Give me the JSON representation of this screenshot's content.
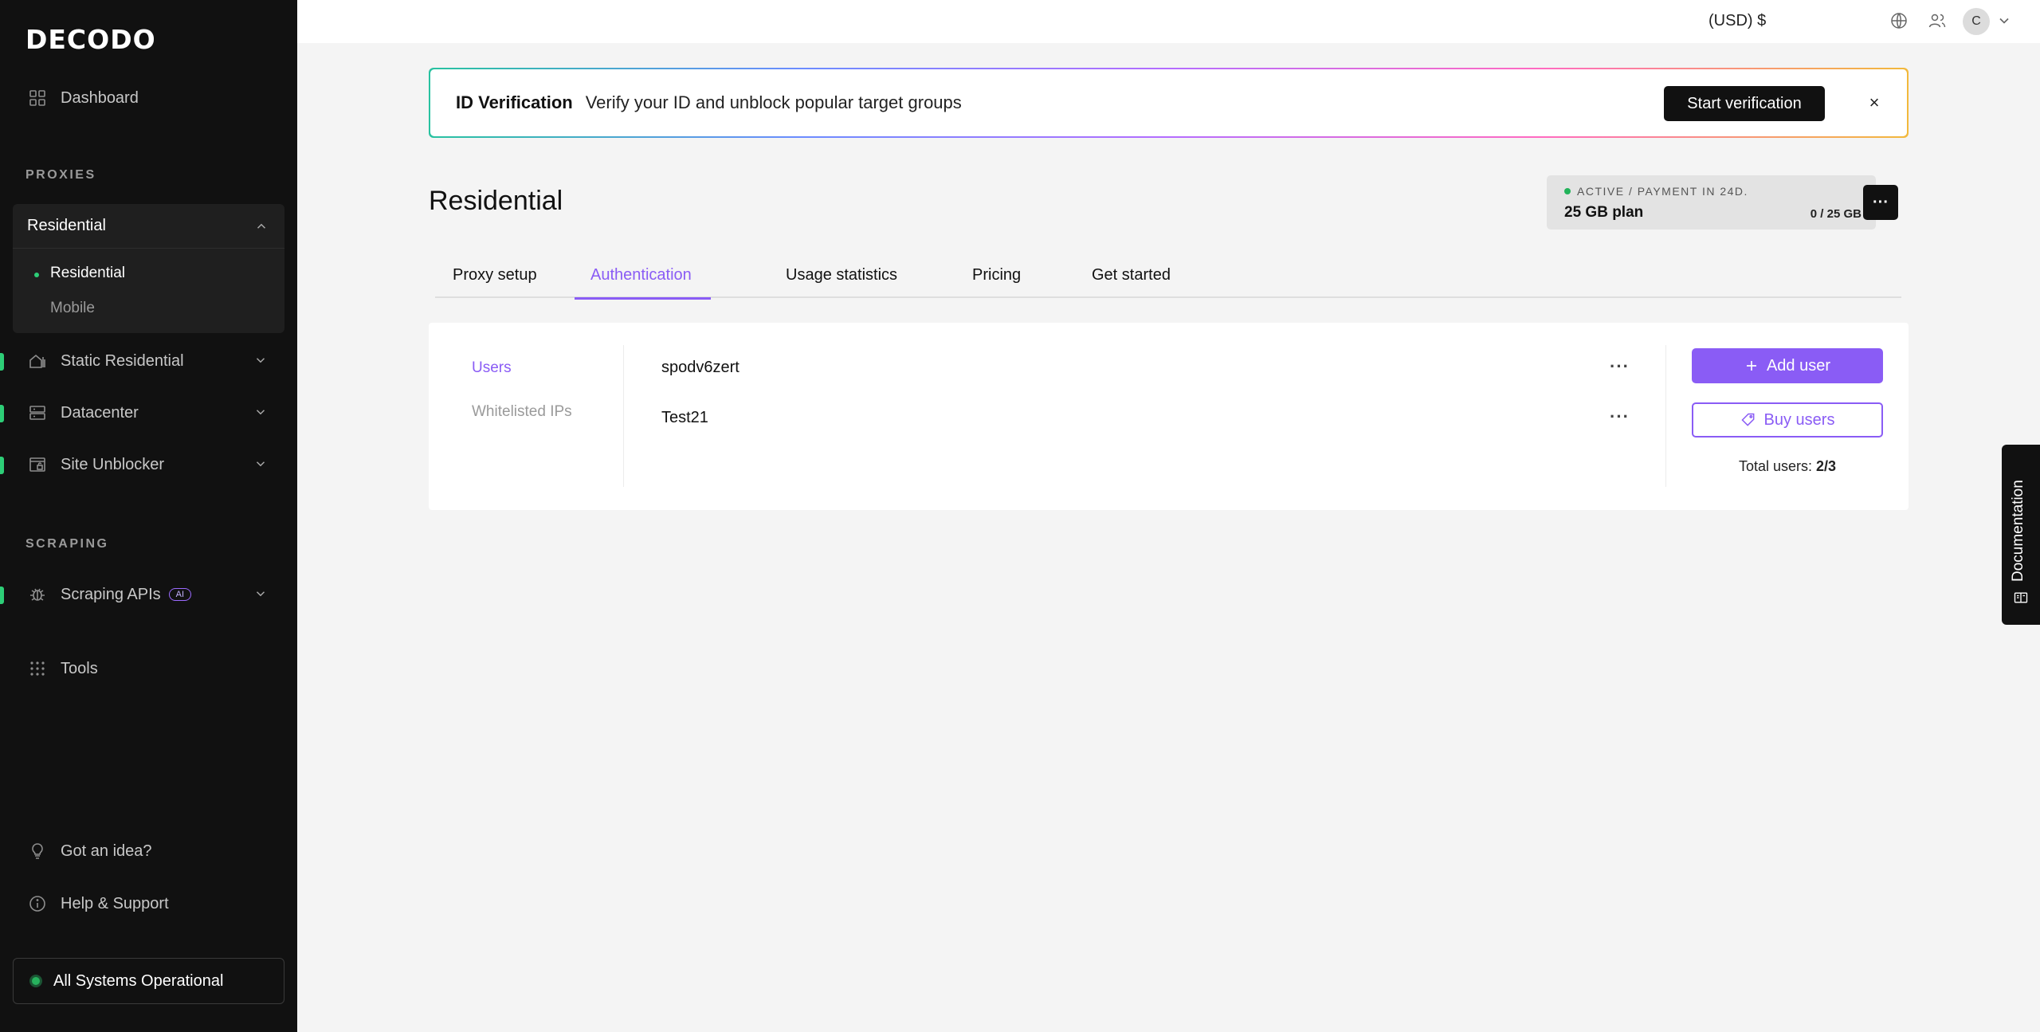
{
  "sidebar": {
    "logo": "DECODO",
    "dashboard": "Dashboard",
    "section_proxies": "PROXIES",
    "residential_group": "Residential",
    "residential_sub": [
      "Residential",
      "Mobile"
    ],
    "static_residential": "Static Residential",
    "datacenter": "Datacenter",
    "site_unblocker": "Site Unblocker",
    "section_scraping": "SCRAPING",
    "scraping_apis": "Scraping APIs",
    "ai_badge": "AI",
    "tools": "Tools",
    "got_idea": "Got an idea?",
    "help_support": "Help & Support",
    "status": "All Systems Operational"
  },
  "topbar": {
    "currency": "(USD) $",
    "avatar_initial": "C"
  },
  "banner": {
    "title": "ID Verification",
    "text": "Verify your ID and unblock popular target groups",
    "button": "Start verification",
    "close": "×"
  },
  "page": {
    "title": "Residential",
    "plan_status": "ACTIVE / PAYMENT IN 24D.",
    "plan_name": "25 GB plan",
    "plan_usage": "0 / 25 GB",
    "more": "···"
  },
  "tabs": [
    "Proxy setup",
    "Authentication",
    "Usage statistics",
    "Pricing",
    "Get started"
  ],
  "auth": {
    "nav_users": "Users",
    "nav_whitelisted": "Whitelisted IPs",
    "users": [
      "spodv6zert",
      "Test21"
    ],
    "row_more": "···",
    "add_user": "Add user",
    "buy_users": "Buy users",
    "total_label": "Total users:",
    "total_value": "2/3"
  },
  "documentation": "Documentation",
  "colors": {
    "accent": "#8a5cf5",
    "sidebar_bg": "#111111",
    "status_green": "#27b25d"
  }
}
